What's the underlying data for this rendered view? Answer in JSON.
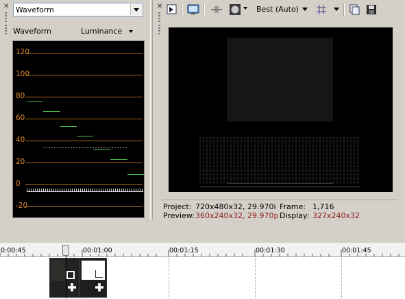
{
  "scopes": {
    "selected_scope": "Waveform",
    "scope_title": "Waveform",
    "mode": "Luminance",
    "y_ticks": [
      "120",
      "100",
      "80",
      "60",
      "40",
      "20",
      "0",
      "-20"
    ]
  },
  "preview": {
    "quality": "Best (Auto)",
    "project_label": "Project:",
    "project_value": "720x480x32, 29.970i",
    "preview_label": "Preview:",
    "preview_value": "360x240x32, 29.970p",
    "frame_label": "Frame:",
    "frame_value": "1,716",
    "display_label": "Display:",
    "display_value": "327x240x32"
  },
  "timeline": {
    "ruler": [
      "0:00:45",
      "00:01:00",
      "00:01:15",
      "00:01:30",
      "00:01:45"
    ]
  },
  "colors": {
    "scope_tick": "#e08a2a",
    "waveform_trace": "#4fbf4f",
    "preview_value_red": "#8b1a1a"
  }
}
